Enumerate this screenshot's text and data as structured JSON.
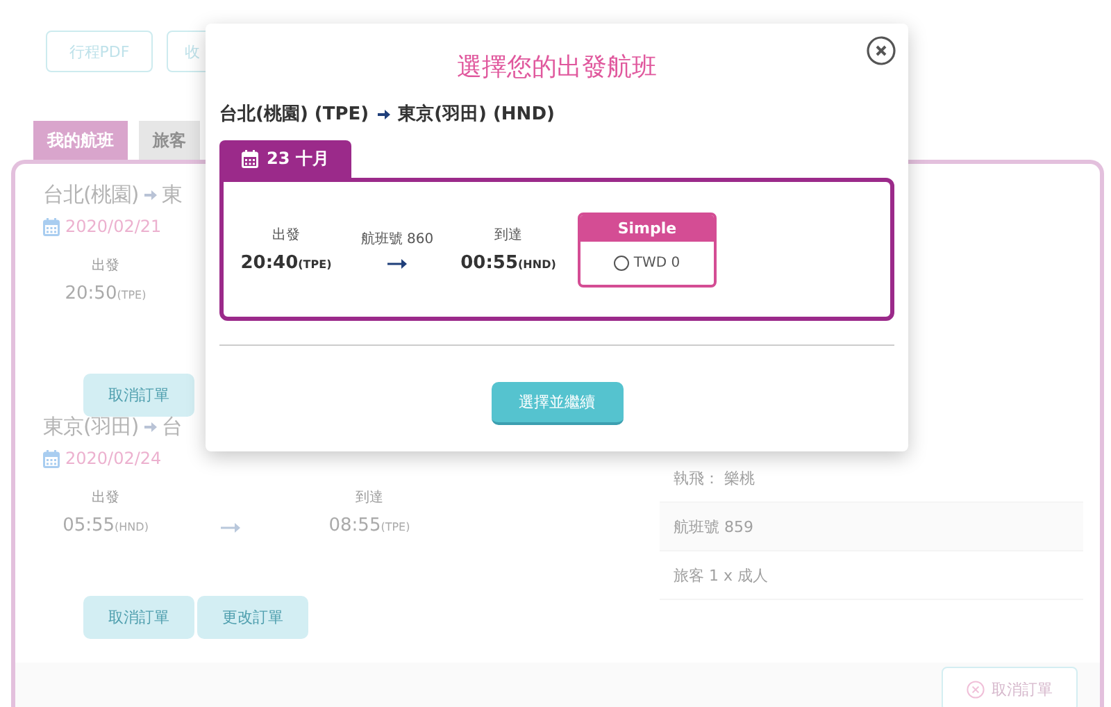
{
  "toolbar_buttons": [
    {
      "label": "行程PDF"
    },
    {
      "label": "收"
    }
  ],
  "tabs": [
    {
      "label": "我的航班",
      "selected": true
    },
    {
      "label": "旅客",
      "selected": false
    }
  ],
  "flights": [
    {
      "from": "台北(桃園)",
      "to": "東",
      "date": "2020/02/21",
      "departure": {
        "label": "出發",
        "time": "20:50",
        "airport": "(TPE)"
      },
      "buttons": [
        "取消訂單"
      ]
    },
    {
      "from": "東京(羽田)",
      "to": "台",
      "date": "2020/02/24",
      "departure": {
        "label": "出發",
        "time": "05:55",
        "airport": "(HND)"
      },
      "arrival": {
        "label": "到達",
        "time": "08:55",
        "airport": "(TPE)"
      },
      "buttons": [
        "取消訂單",
        "更改訂單"
      ],
      "details": [
        "執飛： 樂桃",
        "航班號 859",
        "旅客 1 x 成人"
      ]
    }
  ],
  "footer_button": "取消訂單",
  "modal": {
    "title": "選擇您的出發航班",
    "route": {
      "from": "台北(桃園) (TPE)",
      "to": "東京(羽田) (HND)"
    },
    "date_tab": "23 十月",
    "flight": {
      "departure": {
        "label": "出發",
        "time": "20:40",
        "airport": "(TPE)"
      },
      "flight_number": "航班號 860",
      "arrival": {
        "label": "到達",
        "time": "00:55",
        "airport": "(HND)"
      }
    },
    "fares": [
      {
        "name": "Simple",
        "price": "TWD 0",
        "selected": false
      }
    ],
    "action": "選擇並繼續"
  }
}
